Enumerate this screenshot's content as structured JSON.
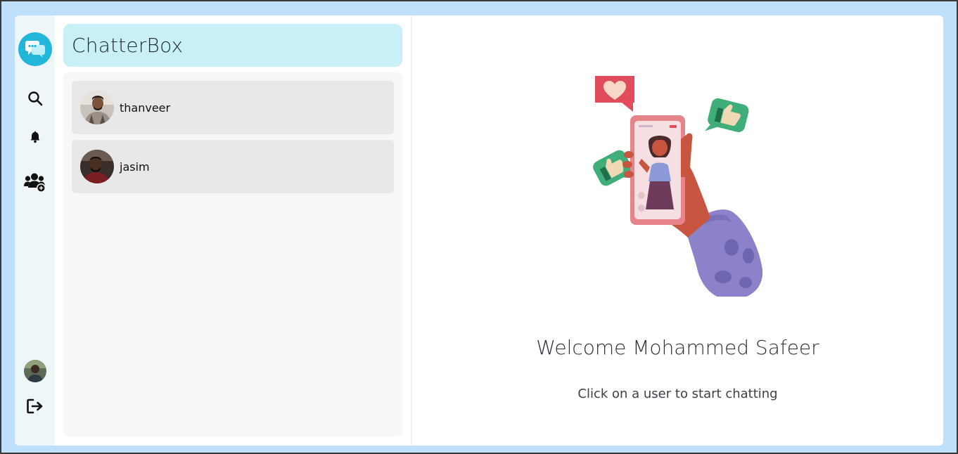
{
  "app": {
    "title": "ChatterBox"
  },
  "sidebar": {
    "icons": [
      "chat-logo-icon",
      "search-icon",
      "bell-icon",
      "group-add-icon",
      "profile-avatar",
      "logout-icon"
    ]
  },
  "users": [
    {
      "name": "thanveer"
    },
    {
      "name": "jasim"
    }
  ],
  "welcome": {
    "title": "Welcome Mohammed Safeer",
    "hint": "Click on a user to start chatting"
  },
  "colors": {
    "background": "#bfe0fb",
    "logo": "#22b6d8",
    "brand_bar": "#c9eff7",
    "user_card": "#e8e8e8"
  }
}
